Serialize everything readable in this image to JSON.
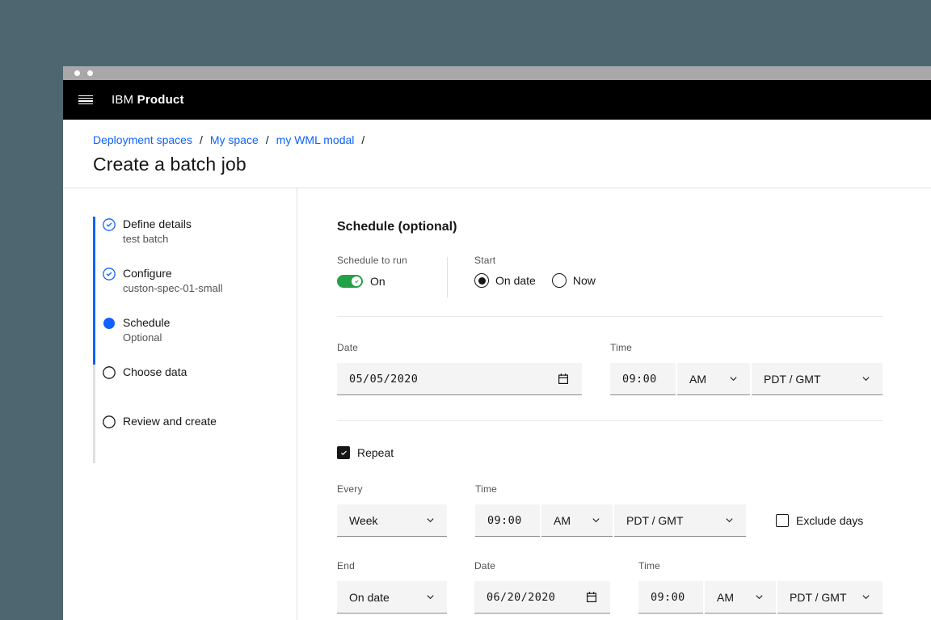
{
  "window": {
    "header": {
      "brand_prefix": "IBM ",
      "brand_name": "Product"
    }
  },
  "breadcrumb": {
    "separator": "/",
    "items": [
      {
        "label": "Deployment spaces"
      },
      {
        "label": "My space"
      },
      {
        "label": "my WML modal"
      }
    ]
  },
  "page": {
    "title": "Create a batch job"
  },
  "progress": {
    "steps": [
      {
        "label": "Define details",
        "sublabel": "test batch",
        "state": "complete"
      },
      {
        "label": "Configure",
        "sublabel": "custon-spec-01-small",
        "state": "complete"
      },
      {
        "label": "Schedule",
        "sublabel": "Optional",
        "state": "current"
      },
      {
        "label": "Choose data",
        "sublabel": "",
        "state": "incomplete"
      },
      {
        "label": "Review and create",
        "sublabel": "",
        "state": "incomplete"
      }
    ]
  },
  "form": {
    "heading": "Schedule (optional)",
    "schedule_to_run": {
      "label": "Schedule to run",
      "state_label": "On",
      "on": true
    },
    "start": {
      "label": "Start",
      "options": [
        {
          "label": "On date",
          "selected": true
        },
        {
          "label": "Now",
          "selected": false
        }
      ]
    },
    "start_date": {
      "label": "Date",
      "value": "05/05/2020"
    },
    "start_time": {
      "label": "Time",
      "value": "09:00",
      "meridiem": "AM",
      "timezone": "PDT / GMT"
    },
    "repeat": {
      "label": "Repeat",
      "checked": true
    },
    "every": {
      "label": "Every",
      "value": "Week"
    },
    "repeat_time": {
      "label": "Time",
      "value": "09:00",
      "meridiem": "AM",
      "timezone": "PDT / GMT"
    },
    "exclude_days": {
      "label": "Exclude days",
      "checked": false
    },
    "end": {
      "label": "End",
      "value": "On date"
    },
    "end_date": {
      "label": "Date",
      "value": "06/20/2020"
    },
    "end_time": {
      "label": "Time",
      "value": "09:00",
      "meridiem": "AM",
      "timezone": "PDT / GMT"
    }
  },
  "colors": {
    "accent_blue": "#0f62fe",
    "toggle_green": "#24a148",
    "background_slate": "#4d6670",
    "titlebar_gray": "#a8a8a8",
    "header_black": "#000000",
    "text_primary": "#161616",
    "text_secondary": "#525252",
    "field_bg": "#f4f4f4",
    "field_underline": "#8d8d8d",
    "divider": "#e0e0e0"
  }
}
